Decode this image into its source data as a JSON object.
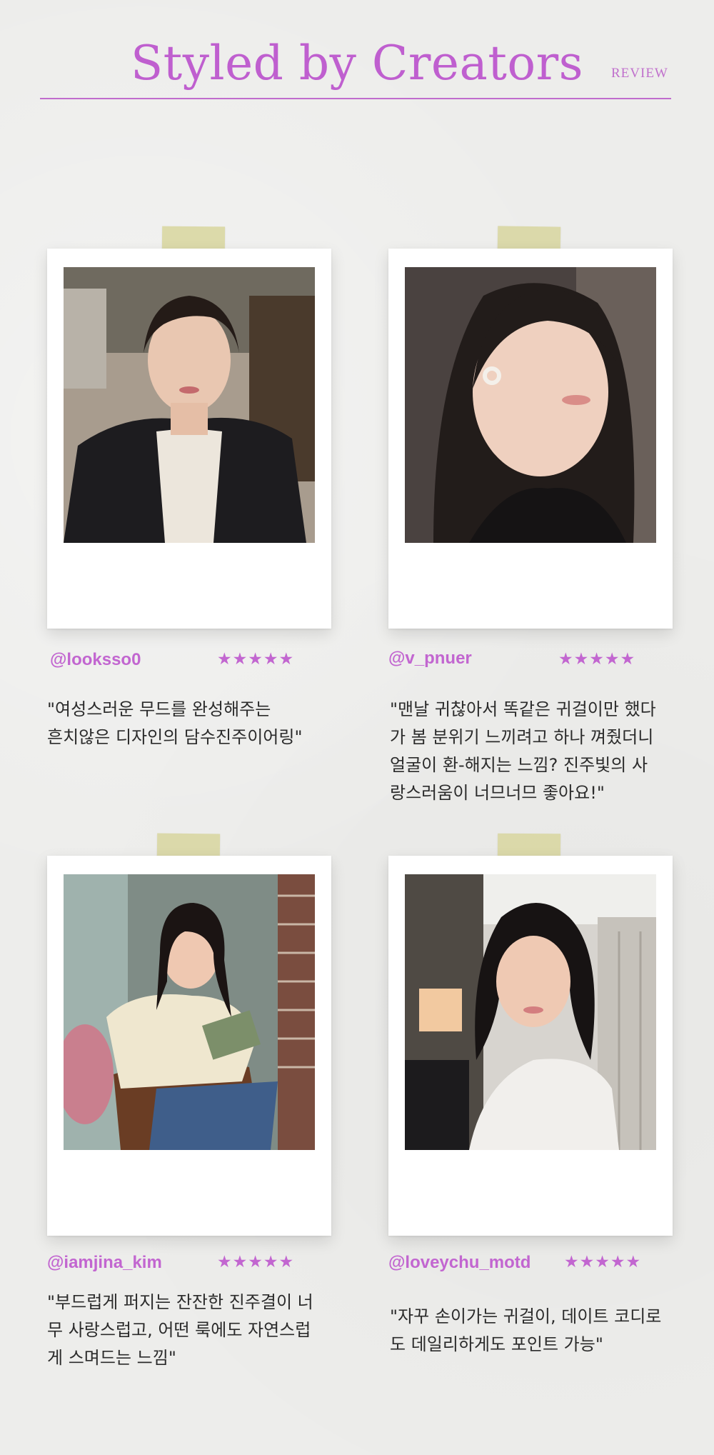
{
  "header": {
    "title": "Styled by Creators",
    "tag": "REVIEW"
  },
  "reviews": [
    {
      "handle": "@looksso0",
      "rating": 5,
      "stars": "★★★★★",
      "text": "\"여성스러운 무드를 완성해주는\n흔치않은 디자인의 담수진주이어링\""
    },
    {
      "handle": "@v_pnuer",
      "rating": 5,
      "stars": "★★★★★",
      "text": "\"맨날 귀찮아서 똑같은 귀걸이만 했다\n가 봄 분위기 느끼려고 하나 껴줬더니\n얼굴이 환-해지는 느낌? 진주빛의 사\n랑스러움이 너므너므 좋아요!\""
    },
    {
      "handle": "@iamjina_kim",
      "rating": 5,
      "stars": "★★★★★",
      "text": "\"부드럽게 퍼지는 잔잔한 진주결이 너\n무 사랑스럽고, 어떤 룩에도 자연스럽\n게 스며드는 느낌\""
    },
    {
      "handle": "@loveychu_motd",
      "rating": 5,
      "stars": "★★★★★",
      "text": "\"자꾸 손이가는 귀걸이, 데이트 코디로\n도 데일리하게도 포인트 가능\""
    }
  ],
  "colors": {
    "accent": "#c266d0",
    "tape": "#d8d6a0",
    "card": "#ffffff",
    "background": "#ededeb"
  }
}
